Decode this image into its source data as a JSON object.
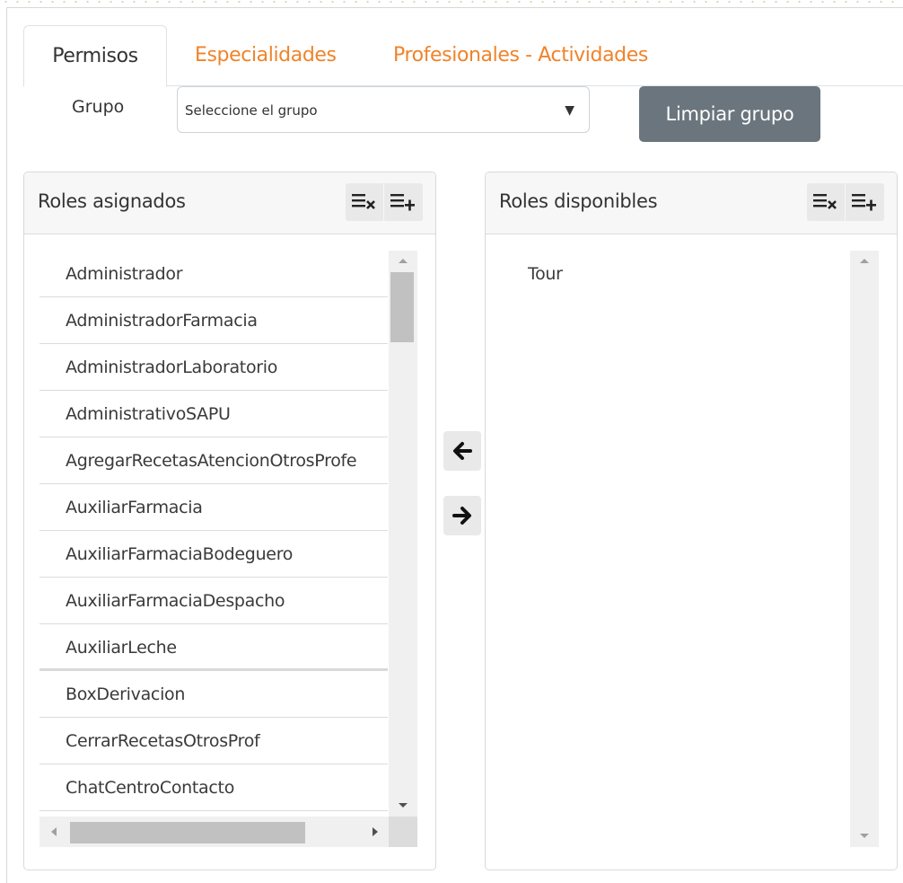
{
  "tabs": [
    {
      "label": "Permisos",
      "active": true
    },
    {
      "label": "Especialidades",
      "active": false
    },
    {
      "label": "Profesionales - Actividades",
      "active": false
    }
  ],
  "grupo": {
    "label": "Grupo",
    "select_value": "Seleccione el grupo",
    "clear_button": "Limpiar grupo"
  },
  "assigned": {
    "title": "Roles asignados",
    "items": [
      "Administrador",
      "AdministradorFarmacia",
      "AdministradorLaboratorio",
      "AdministrativoSAPU",
      "AgregarRecetasAtencionOtrosProfe",
      "AuxiliarFarmacia",
      "AuxiliarFarmaciaBodeguero",
      "AuxiliarFarmaciaDespacho",
      "AuxiliarLeche",
      "BoxDerivacion",
      "CerrarRecetasOtrosProf",
      "ChatCentroContacto"
    ]
  },
  "available": {
    "title": "Roles disponibles",
    "items": [
      "Tour"
    ]
  },
  "icons": {
    "remove_all": "list-remove-icon",
    "add_all": "list-add-icon",
    "move_left": "arrow-left-icon",
    "move_right": "arrow-right-icon",
    "select_arrow": "▼"
  },
  "colors": {
    "tab_inactive": "#f0832a",
    "button_bg": "#6b757d"
  }
}
